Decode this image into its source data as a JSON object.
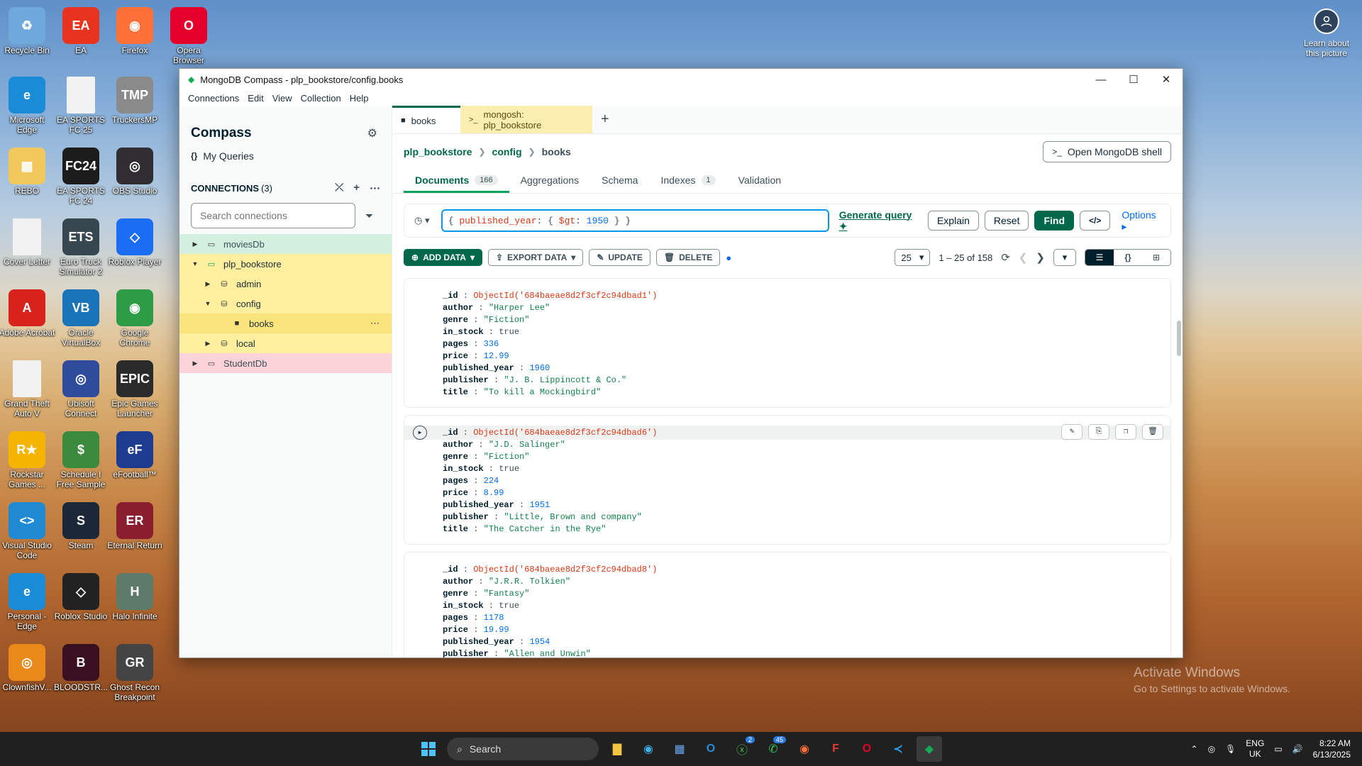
{
  "desktop": {
    "icons": [
      {
        "label": "Recycle Bin",
        "glyph": "♻",
        "color": "#6fa8dc"
      },
      {
        "label": "EA",
        "glyph": "EA",
        "color": "#e8341f"
      },
      {
        "label": "Firefox",
        "glyph": "◉",
        "color": "#ff7139"
      },
      {
        "label": "Opera Browser",
        "glyph": "O",
        "color": "#e4002b"
      },
      {
        "label": "Microsoft Edge",
        "glyph": "e",
        "color": "#1a8bd6"
      },
      {
        "label": "EA SPORTS FC 25",
        "glyph": "",
        "color": "#f2f2f2"
      },
      {
        "label": "TruckersMP",
        "glyph": "TMP",
        "color": "#8a8a8a"
      },
      {
        "label": "REBO",
        "glyph": "▦",
        "color": "#f2c75c"
      },
      {
        "label": "EA SPORTS FC 24",
        "glyph": "FC24",
        "color": "#1c1c1c"
      },
      {
        "label": "OBS Studio",
        "glyph": "◎",
        "color": "#302e31"
      },
      {
        "label": "Cover Letter",
        "glyph": "",
        "color": "#f2f2f2"
      },
      {
        "label": "Euro Truck Simulator 2",
        "glyph": "ETS",
        "color": "#37474f"
      },
      {
        "label": "Roblox Player",
        "glyph": "◇",
        "color": "#1b6ef3"
      },
      {
        "label": "Adobe Acrobat",
        "glyph": "A",
        "color": "#d7231b"
      },
      {
        "label": "Oracle VirtualBox",
        "glyph": "VB",
        "color": "#1a74b8"
      },
      {
        "label": "Google Chrome",
        "glyph": "◉",
        "color": "#2e9b46"
      },
      {
        "label": "Grand Theft Auto V",
        "glyph": "",
        "color": "#f2f2f2"
      },
      {
        "label": "Ubisoft Connect",
        "glyph": "◎",
        "color": "#2f4b9c"
      },
      {
        "label": "Epic Games Launcher",
        "glyph": "EPIC",
        "color": "#2a2a2a"
      },
      {
        "label": "Rockstar Games ...",
        "glyph": "R★",
        "color": "#f4b400"
      },
      {
        "label": "Schedule I Free Sample",
        "glyph": "$",
        "color": "#3b8a3e"
      },
      {
        "label": "eFootball™",
        "glyph": "eF",
        "color": "#1d3c8f"
      },
      {
        "label": "Visual Studio Code",
        "glyph": "<>",
        "color": "#1f8ad2"
      },
      {
        "label": "Steam",
        "glyph": "S",
        "color": "#1b2838"
      },
      {
        "label": "Eternal Return",
        "glyph": "ER",
        "color": "#8b1e2e"
      },
      {
        "label": "Personal - Edge",
        "glyph": "e",
        "color": "#1a8bd6"
      },
      {
        "label": "Roblox Studio",
        "glyph": "◇",
        "color": "#222"
      },
      {
        "label": "Halo Infinite",
        "glyph": "H",
        "color": "#5d7a6b"
      },
      {
        "label": "ClownfishV...",
        "glyph": "◎",
        "color": "#e8891a"
      },
      {
        "label": "BLOODSTR...",
        "glyph": "B",
        "color": "#3a1020"
      },
      {
        "label": "Ghost Recon Breakpoint",
        "glyph": "GR",
        "color": "#444"
      }
    ],
    "learn_label": "Learn about this picture",
    "activate_title": "Activate Windows",
    "activate_sub": "Go to Settings to activate Windows."
  },
  "window": {
    "title": "MongoDB Compass - plp_bookstore/config.books",
    "menu": [
      "Connections",
      "Edit",
      "View",
      "Collection",
      "Help"
    ]
  },
  "sidebar": {
    "title": "Compass",
    "my_queries": "My Queries",
    "connections_label": "CONNECTIONS",
    "connections_count": "(3)",
    "search_placeholder": "Search connections",
    "tree": [
      {
        "label": "moviesDb"
      },
      {
        "label": "plp_bookstore"
      },
      {
        "label": "admin"
      },
      {
        "label": "config"
      },
      {
        "label": "books"
      },
      {
        "label": "local"
      },
      {
        "label": "StudentDb"
      }
    ]
  },
  "tabs": {
    "books": "books",
    "shell": "mongosh: plp_bookstore"
  },
  "breadcrumb": {
    "db": "plp_bookstore",
    "coll_group": "config",
    "coll": "books"
  },
  "open_shell": "Open MongoDB shell",
  "subtabs": {
    "documents": "Documents",
    "documents_count": "166",
    "aggregations": "Aggregations",
    "schema": "Schema",
    "indexes": "Indexes",
    "indexes_count": "1",
    "validation": "Validation"
  },
  "query": {
    "field": "published_year",
    "op": "$gt",
    "value": "1950",
    "generate": "Generate query",
    "explain": "Explain",
    "reset": "Reset",
    "find": "Find",
    "options": "Options"
  },
  "toolbar": {
    "add": "ADD DATA",
    "export": "EXPORT DATA",
    "update": "UPDATE",
    "delete": "DELETE",
    "page_size": "25",
    "range": "1 – 25 of 158"
  },
  "documents": [
    {
      "id": "ObjectId('684baeae8d2f3cf2c94dbad1')",
      "author": "\"Harper Lee\"",
      "genre": "\"Fiction\"",
      "in_stock": "true",
      "pages": "336",
      "price": "12.99",
      "published_year": "1960",
      "publisher": "\"J. B. Lippincott & Co.\"",
      "title": "\"To kill a Mockingbird\""
    },
    {
      "id": "ObjectId('684baeae8d2f3cf2c94dbad6')",
      "author": "\"J.D. Salinger\"",
      "genre": "\"Fiction\"",
      "in_stock": "true",
      "pages": "224",
      "price": "8.99",
      "published_year": "1951",
      "publisher": "\"Little, Brown and company\"",
      "title": "\"The Catcher in the Rye\""
    },
    {
      "id": "ObjectId('684baeae8d2f3cf2c94dbad8')",
      "author": "\"J.R.R. Tolkien\"",
      "genre": "\"Fantasy\"",
      "in_stock": "true",
      "pages": "1178",
      "price": "19.99",
      "published_year": "1954",
      "publisher": "\"Allen and Unwin\"",
      "title": ""
    }
  ],
  "taskbar": {
    "search": "Search",
    "badge_xbox": "2",
    "badge_whatsapp": "45",
    "lang1": "ENG",
    "lang2": "UK",
    "time": "8:22 AM",
    "date": "6/13/2025"
  }
}
